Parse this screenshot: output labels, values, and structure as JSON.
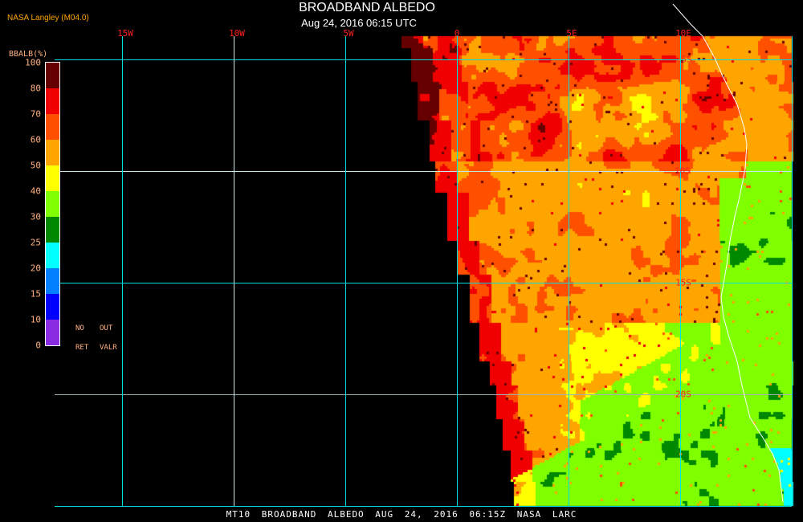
{
  "header": {
    "title": "BROADBAND ALBEDO",
    "subtitle": "Aug 24, 2016 06:15 UTC",
    "credit": "NASA Langley (M04.0)"
  },
  "legend": {
    "title": "BBALB(%)",
    "ticks": [
      "100",
      "80",
      "70",
      "60",
      "50",
      "40",
      "30",
      "25",
      "20",
      "15",
      "10",
      "0"
    ],
    "colors": [
      "#660000",
      "#f00000",
      "#ff5000",
      "#ffa500",
      "#ffff00",
      "#80ff00",
      "#008800",
      "#00ffff",
      "#0080ff",
      "#0000ff",
      "#8a2be2"
    ],
    "no_retrieval": [
      "NO",
      "RET"
    ],
    "out_valr": [
      "OUT",
      "VALR"
    ]
  },
  "map": {
    "lon_labels": [
      "15W",
      "10W",
      "5W",
      "0",
      "5E",
      "10E"
    ],
    "lat_labels": [
      "5S",
      "10S",
      "15S",
      "20S"
    ],
    "gridline_color": "#00e0e0",
    "coastline_color": "#ffffff"
  },
  "footer": {
    "text": "MT10  BROADBAND ALBEDO   AUG 24, 2016 06:15Z   NASA LARC"
  }
}
